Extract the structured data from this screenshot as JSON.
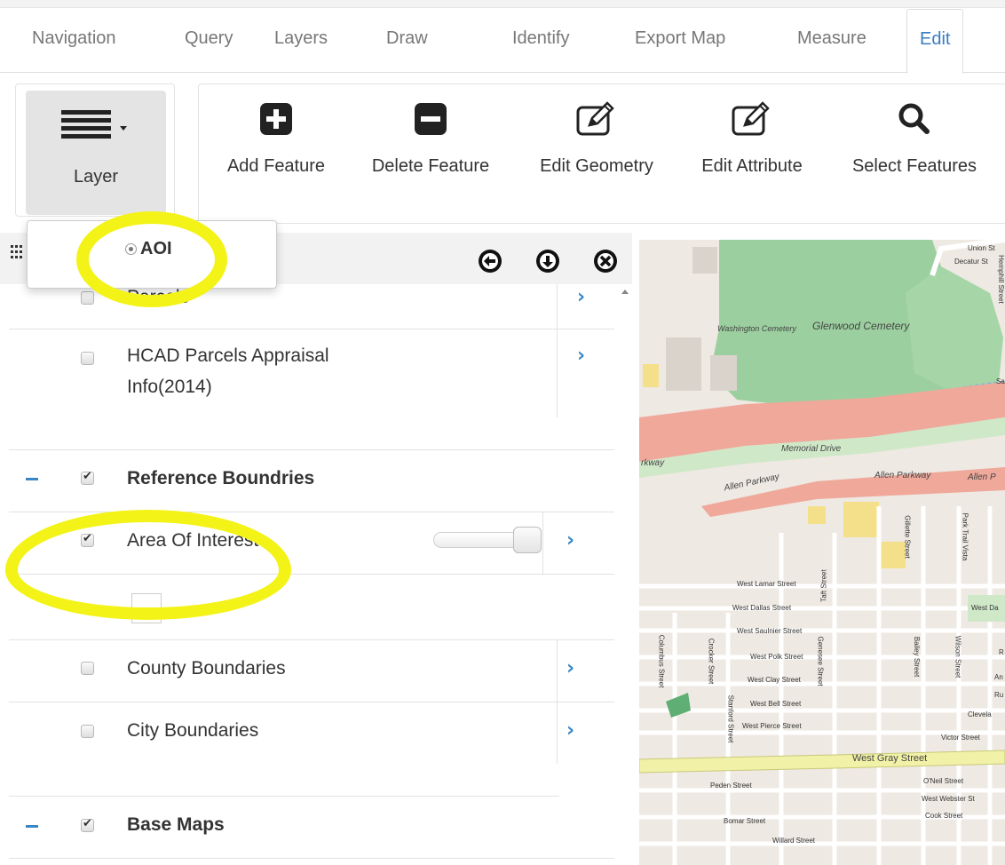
{
  "tabs": [
    {
      "label": "Navigation",
      "active": false
    },
    {
      "label": "Query",
      "active": false
    },
    {
      "label": "Layers",
      "active": false
    },
    {
      "label": "Draw",
      "active": false
    },
    {
      "label": "Identify",
      "active": false
    },
    {
      "label": "Export Map",
      "active": false
    },
    {
      "label": "Measure",
      "active": false
    },
    {
      "label": "Edit",
      "active": true
    }
  ],
  "toolbar": {
    "layer_label": "Layer",
    "tools": [
      {
        "label": "Add Feature",
        "icon": "plus-square-icon"
      },
      {
        "label": "Delete Feature",
        "icon": "minus-square-icon"
      },
      {
        "label": "Edit Geometry",
        "icon": "edit-icon"
      },
      {
        "label": "Edit Attribute",
        "icon": "edit-icon"
      },
      {
        "label": "Select Features",
        "icon": "search-icon"
      }
    ]
  },
  "layer_dropdown": {
    "options": [
      {
        "label": "AOI",
        "selected": true
      }
    ]
  },
  "panel": {
    "rows": [
      {
        "label": "Parcels",
        "checked": false
      },
      {
        "label_line1": "HCAD Parcels Appraisal",
        "label_line2": "Info(2014)",
        "checked": false
      },
      {
        "label": "Reference Boundries",
        "checked": true,
        "group": true
      },
      {
        "label": "Area Of Interest",
        "checked": true,
        "opacity": 1.0
      },
      {
        "label": "County Boundaries",
        "checked": false
      },
      {
        "label": "City Boundaries",
        "checked": false
      },
      {
        "label": "Base Maps",
        "checked": true,
        "group": true
      }
    ]
  },
  "map": {
    "labels": {
      "washington": "Washington Cemetery",
      "glenwood": "Glenwood Cemetery",
      "memorial": "Memorial Drive",
      "allen1": "Allen Parkway",
      "allen2": "Allen Parkway",
      "allen3": "Allen P",
      "parkway": "rkway",
      "union": "Union St",
      "decatur": "Decatur St",
      "hemphill": "Hemphill Street",
      "w_lamar": "West Lamar Street",
      "w_dallas": "West Dallas Street",
      "w_saulnier": "West Saulnier Street",
      "w_polk": "West Polk Street",
      "w_clay": "West Clay Street",
      "w_bell": "West Bell Street",
      "w_pierce": "West Pierce Street",
      "w_gray": "West Gray Street",
      "peden": "Peden Street",
      "oneil": "O'Neil Street",
      "w_webster": "West Webster St",
      "cook": "Cook Street",
      "bomar": "Bomar Street",
      "willard": "Willard Street",
      "victor": "Victor Street",
      "taft": "Taft Street",
      "gillette": "Gillette Street",
      "park_trail": "Park Trail Vista",
      "w_da": "West Da",
      "columbus": "Columbus Street",
      "crocker": "Crocker Street",
      "stanford": "Stanford Street",
      "genesee": "Genesee Street",
      "bailey": "Bailey Street",
      "wilson": "Wilson Street",
      "clevela": "Clevela",
      "an": "An",
      "ru": "Ru",
      "sa": "Sa",
      "r": "R"
    }
  },
  "colors": {
    "accent": "#3a87c8",
    "highlight": "#f3f317",
    "cemetery": "#8fc89a",
    "parkway": "#e9a18e"
  }
}
